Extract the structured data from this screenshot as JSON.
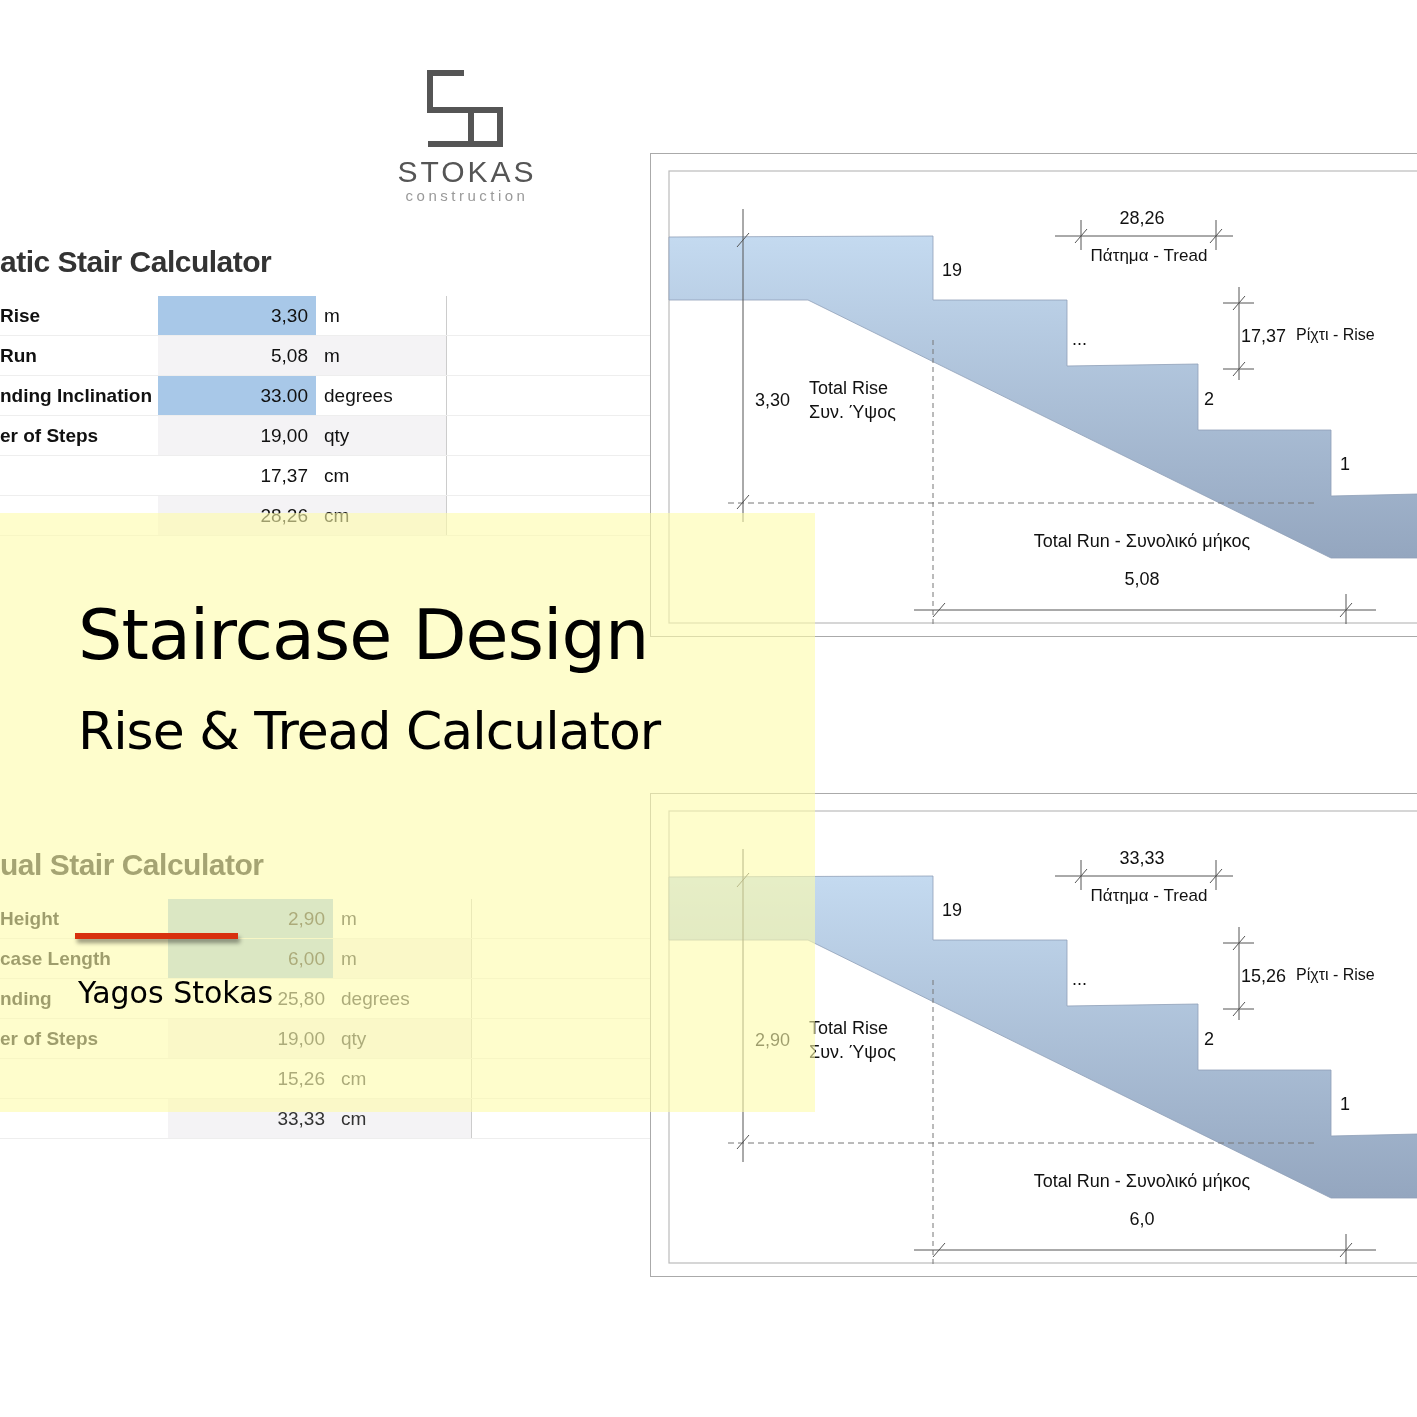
{
  "logo": {
    "name": "STOKAS",
    "tagline": "construction"
  },
  "calculators": [
    {
      "title": "atic Stair Calculator",
      "rows": [
        {
          "label": "Rise",
          "value": "3,30",
          "unit": "m",
          "highlighted": true
        },
        {
          "label": "Run",
          "value": "5,08",
          "unit": "m",
          "highlighted": false
        },
        {
          "label": "nding Inclination",
          "value": "33.00",
          "unit": "degrees",
          "highlighted": true
        },
        {
          "label": "er of Steps",
          "value": "19,00",
          "unit": "qty",
          "highlighted": false
        },
        {
          "value": "17,37",
          "unit": "cm",
          "highlighted": false
        },
        {
          "value": "28,26",
          "unit": "cm",
          "highlighted": false
        }
      ]
    },
    {
      "title": "ual Stair Calculator",
      "rows": [
        {
          "label": "Height",
          "value": "2,90",
          "unit": "m",
          "highlighted": true
        },
        {
          "label": "case Length",
          "value": "6,00",
          "unit": "m",
          "highlighted": true
        },
        {
          "label": "nding",
          "value": "25,80",
          "unit": "degrees",
          "highlighted": false
        },
        {
          "label": "er of Steps",
          "value": "19,00",
          "unit": "qty",
          "highlighted": false
        },
        {
          "value": "15,26",
          "unit": "cm",
          "highlighted": false
        },
        {
          "value": "33,33",
          "unit": "cm",
          "highlighted": false
        }
      ]
    }
  ],
  "diagrams": [
    {
      "tread": "28,26",
      "tread_label": "Πάτημα - Tread",
      "rise": "17,37",
      "rise_label": "Ρίχτι - Rise",
      "total_rise": "3,30",
      "total_rise_label": [
        "Total Rise",
        "Συν. Ύψος"
      ],
      "total_run_label": "Total Run - Συνολικό μήκος",
      "total_run": "5,08",
      "step_labels": [
        "19",
        "...",
        "2",
        "1"
      ]
    },
    {
      "tread": "33,33",
      "tread_label": "Πάτημα - Tread",
      "rise": "15,26",
      "rise_label": "Ρίχτι - Rise",
      "total_rise": "2,90",
      "total_rise_label": [
        "Total Rise",
        "Συν. Ύψος"
      ],
      "total_run_label": "Total Run - Συνολικό μήκος",
      "total_run": "6,0",
      "step_labels": [
        "19",
        "...",
        "2",
        "1"
      ]
    }
  ],
  "cover": {
    "title": "Staircase Design",
    "subtitle": "Rise & Tread Calculator",
    "author": "Yagos Stokas"
  }
}
